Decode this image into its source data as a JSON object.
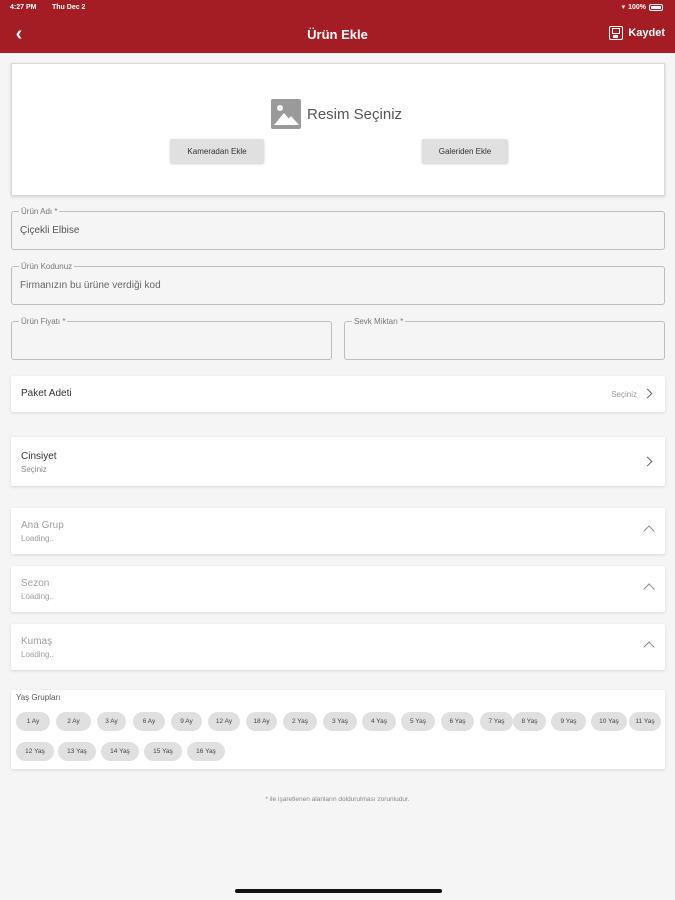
{
  "status_bar": {
    "time": "4:27 PM",
    "date": "Thu Dec 2",
    "battery": "100%"
  },
  "app_bar": {
    "title": "Ürün Ekle",
    "save_label": "Kaydet"
  },
  "image_picker": {
    "label": "Resim Seçiniz",
    "camera_button": "Kameradan Ekle",
    "gallery_button": "Galeriden Ekle"
  },
  "fields": {
    "product_name": {
      "label": "Ürün Adı *",
      "value": "Çiçekli Elbise"
    },
    "product_code": {
      "label": "Ürün Kodunuz",
      "value": "Firmanızın bu ürüne verdiği kod"
    },
    "price": {
      "label": "Ürün Fiyatı *",
      "value": ""
    },
    "shipment_qty": {
      "label": "Sevk Miktarı *",
      "value": ""
    }
  },
  "package_count": {
    "label": "Paket Adeti",
    "hint": "Seçiniz"
  },
  "gender": {
    "label": "Cinsiyet",
    "sub": "Seçiniz"
  },
  "dropdowns": [
    {
      "label": "Ana Grup",
      "sub": "Loading.."
    },
    {
      "label": "Sezon",
      "sub": "Loading.."
    },
    {
      "label": "Kumaş",
      "sub": "Loading.."
    }
  ],
  "age_groups": {
    "title": "Yaş Grupları",
    "chips": [
      "1 Ay",
      "2 Ay",
      "3 Ay",
      "6 Ay",
      "9 Ay",
      "12 Ay",
      "18 Ay",
      "2 Yaş",
      "3 Yaş",
      "4 Yaş",
      "5 Yaş",
      "6 Yaş",
      "7 Yaş",
      "8 Yaş",
      "9 Yaş",
      "10 Yaş",
      "11 Yaş",
      "12 Yaş",
      "13 Yaş",
      "14 Yaş",
      "15 Yaş",
      "16 Yaş"
    ]
  },
  "footnote": "* ile işaretlenen alanların doldurulması zorunludur.",
  "colors": {
    "brand": "#a51d24",
    "background": "#f5f5f5"
  }
}
